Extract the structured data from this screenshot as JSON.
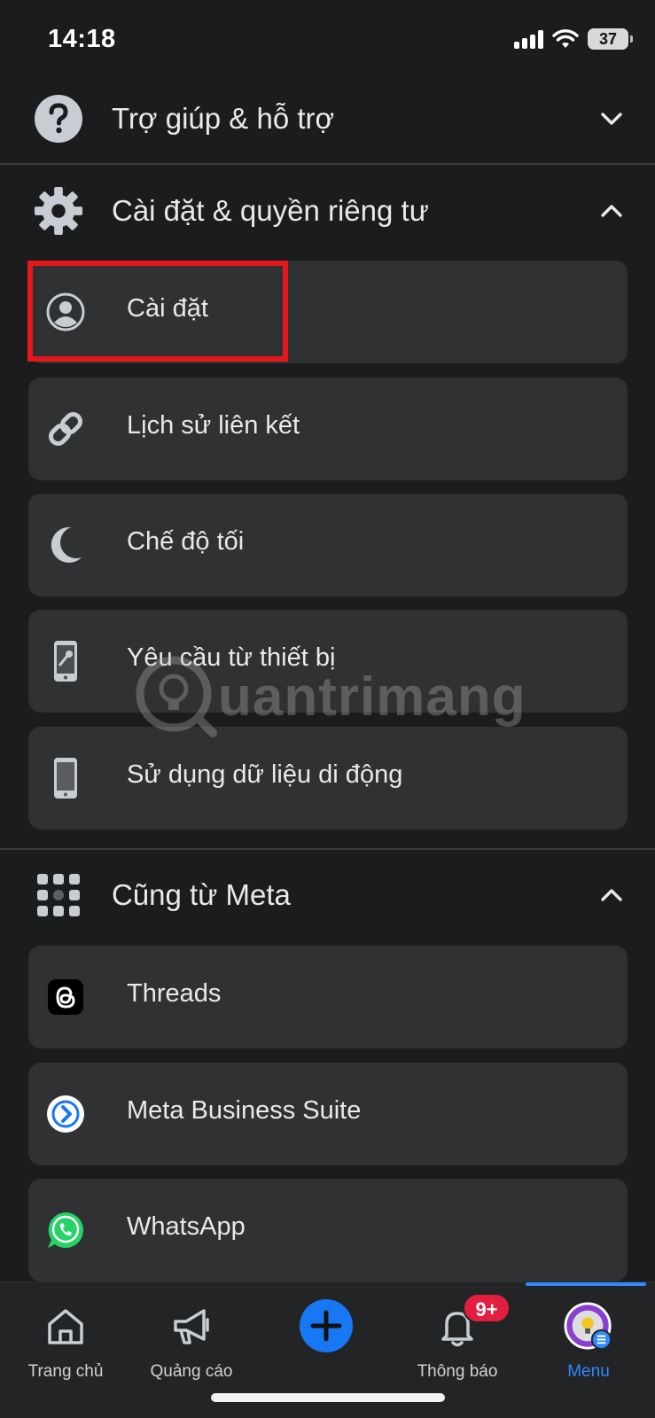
{
  "status_bar": {
    "time": "14:18",
    "battery": "37"
  },
  "sections": {
    "help": {
      "label": "Trợ giúp & hỗ trợ",
      "icon": "question-circle-icon",
      "expanded": false
    },
    "settings_privacy": {
      "label": "Cài đặt & quyền riêng tư",
      "icon": "gear-icon",
      "expanded": true
    },
    "from_meta": {
      "label": "Cũng từ Meta",
      "icon": "grid-icon",
      "expanded": true
    }
  },
  "settings_items": [
    {
      "label": "Cài đặt",
      "icon": "profile-settings-icon"
    },
    {
      "label": "Lịch sử liên kết",
      "icon": "link-icon"
    },
    {
      "label": "Chế độ tối",
      "icon": "moon-icon"
    },
    {
      "label": "Yêu cầu từ thiết bị",
      "icon": "device-key-icon"
    },
    {
      "label": "Sử dụng dữ liệu di động",
      "icon": "phone-icon"
    }
  ],
  "meta_items": [
    {
      "label": "Threads",
      "icon": "threads-icon"
    },
    {
      "label": "Meta Business Suite",
      "icon": "meta-business-suite-icon"
    },
    {
      "label": "WhatsApp",
      "icon": "whatsapp-icon"
    }
  ],
  "watermark": "uantrimang",
  "bottom_nav": {
    "home": "Trang chủ",
    "ads": "Quảng cáo",
    "notifications": "Thông báo",
    "notifications_badge": "9+",
    "menu": "Menu"
  },
  "colors": {
    "accent": "#2e89ff",
    "highlight": "#e5171b",
    "badge": "#e41e3f",
    "background": "#1b1c1e",
    "card": "#303133"
  }
}
